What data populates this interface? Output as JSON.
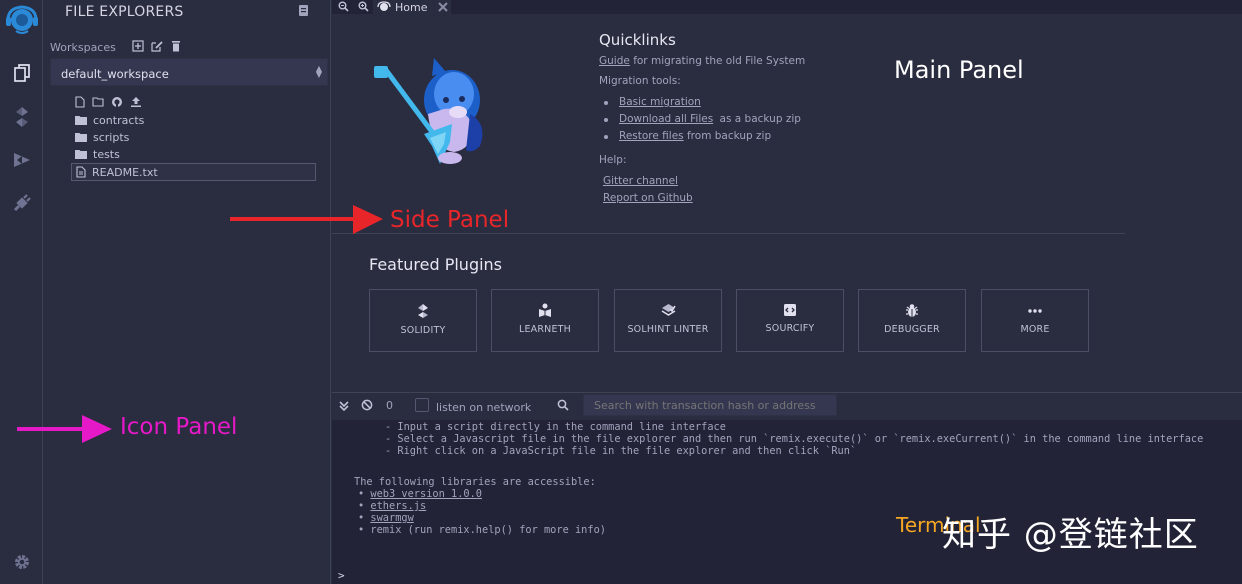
{
  "icon_panel": {
    "icons": [
      "remix-logo-icon",
      "file-explorer-icon",
      "solidity-compiler-icon",
      "deploy-run-icon",
      "plugin-manager-icon",
      "settings-icon"
    ]
  },
  "side_panel": {
    "title": "FILE EXPLORERS",
    "workspaces_label": "Workspaces",
    "workspace_selected": "default_workspace",
    "tree": [
      {
        "type": "folder",
        "name": "contracts"
      },
      {
        "type": "folder",
        "name": "scripts"
      },
      {
        "type": "folder",
        "name": "tests"
      },
      {
        "type": "file",
        "name": "README.txt"
      }
    ]
  },
  "tabs": {
    "home_label": "Home"
  },
  "quicklinks": {
    "title": "Quicklinks",
    "guide_link": "Guide",
    "guide_text": "for migrating the old File System",
    "migration_tools": "Migration tools:",
    "basic_migration": "Basic migration",
    "download_link": "Download all Files",
    "download_text": "as a backup zip",
    "restore_link": "Restore files",
    "restore_text": "from backup zip",
    "help": "Help:",
    "gitter": "Gitter channel",
    "github": "Report on Github"
  },
  "featured": {
    "title": "Featured Plugins",
    "plugins": [
      "SOLIDITY",
      "LEARNETH",
      "SOLHINT LINTER",
      "SOURCIFY",
      "DEBUGGER",
      "MORE"
    ]
  },
  "terminal": {
    "count": "0",
    "listen_label": "listen on network",
    "search_placeholder": "Search with transaction hash or address",
    "lines": [
      "- Input a script directly in the command line interface",
      "- Select a Javascript file in the file explorer and then run `remix.execute()` or `remix.exeCurrent()` in the command line interface",
      "- Right click on a JavaScript file in the file explorer and then click `Run`"
    ],
    "libs_intro": "The following libraries are accessible:",
    "libs": [
      "web3 version 1.0.0",
      "ethers.js",
      "swarmgw"
    ],
    "remix_line": "remix (run remix.help() for more info)",
    "prompt": ">"
  },
  "annotations": {
    "main_panel": "Main Panel",
    "side_panel": "Side Panel",
    "icon_panel": "Icon Panel",
    "terminal": "Terminal",
    "side_color": "#e8262a",
    "icon_color": "#e619c8",
    "terminal_color": "#f5a623"
  },
  "watermark": "知乎 @登链社区",
  "colors": {
    "bg": "#2a2c3f",
    "terminal_bg": "#222336",
    "border": "#3f4455",
    "logo_blue": "#2a8ad8"
  }
}
